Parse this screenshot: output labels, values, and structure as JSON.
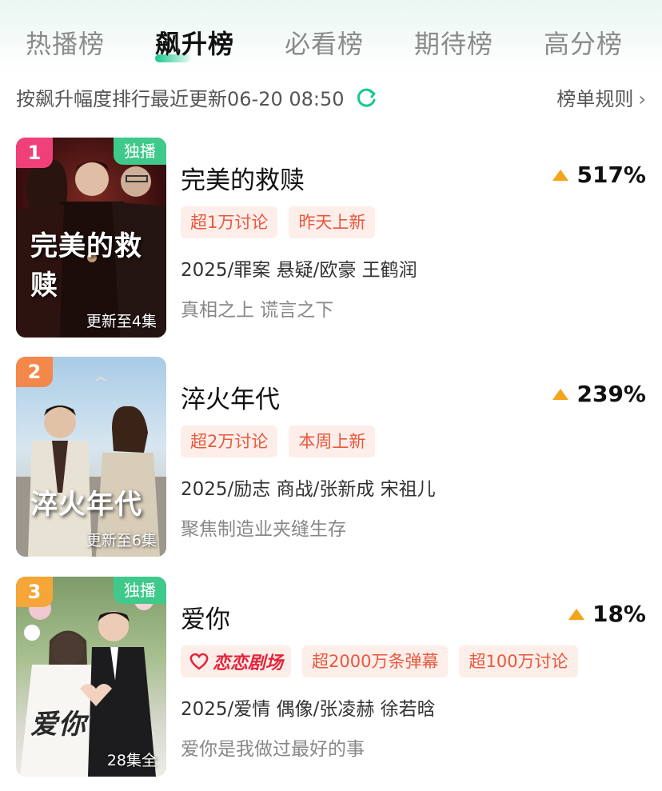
{
  "tabs": [
    {
      "label": "热播榜"
    },
    {
      "label": "飙升榜"
    },
    {
      "label": "必看榜"
    },
    {
      "label": "期待榜"
    },
    {
      "label": "高分榜"
    }
  ],
  "active_tab": "飙升榜",
  "subhead": {
    "text": "按飙升幅度排行最近更新06-20 08:50",
    "rules_label": "榜单规则",
    "refresh_icon": "refresh-icon",
    "chevron": "›"
  },
  "colors": {
    "accent_green": "#16c98b",
    "rank1": "#f0407a",
    "rank2": "#f4874a",
    "rank3": "#f5a636",
    "trend_up": "#f5a31a",
    "tag_text": "#e8583d",
    "tag_bg": "#fdeeea"
  },
  "items": [
    {
      "rank": "1",
      "exclusive": "独播",
      "poster_title": "完美的救赎",
      "poster_update": "更新至4集",
      "title": "完美的救赎",
      "trend": "517%",
      "tags": [
        "超1万讨论",
        "昨天上新"
      ],
      "meta": "2025/罪案 悬疑/欧豪 王鹤润",
      "desc": "真相之上 谎言之下"
    },
    {
      "rank": "2",
      "exclusive": "",
      "poster_title": "淬火年代",
      "poster_update": "更新至6集",
      "title": "淬火年代",
      "trend": "239%",
      "tags": [
        "超2万讨论",
        "本周上新"
      ],
      "meta": "2025/励志 商战/张新成 宋祖儿",
      "desc": "聚焦制造业夹缝生存"
    },
    {
      "rank": "3",
      "exclusive": "独播",
      "poster_title": "爱你",
      "poster_update": "28集全",
      "title": "爱你",
      "trend": "18%",
      "logo_tag": "恋恋剧场",
      "tags": [
        "超2000万条弹幕",
        "超100万讨论"
      ],
      "meta": "2025/爱情 偶像/张凌赫 徐若晗",
      "desc": "爱你是我做过最好的事"
    }
  ]
}
